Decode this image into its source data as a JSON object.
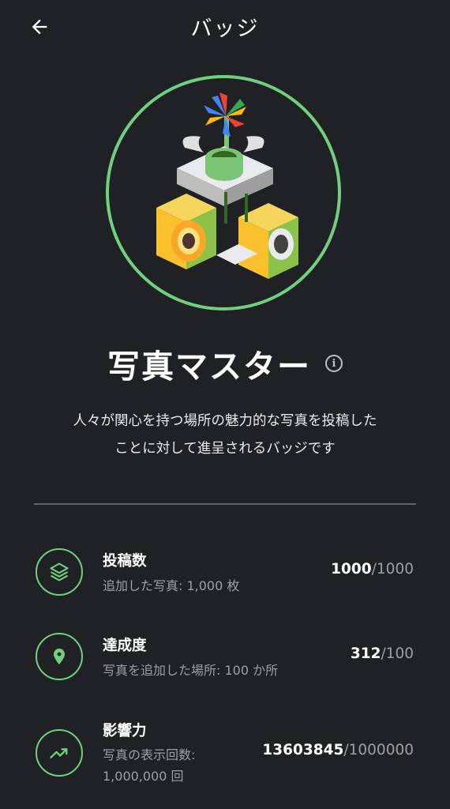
{
  "header": {
    "title": "バッジ",
    "back_icon": "arrow-left-icon"
  },
  "badge": {
    "name": "写真マスター",
    "description_line1": "人々が関心を持つ場所の魅力的な写真を投稿した",
    "description_line2": "ことに対して進呈されるバッジです",
    "ring_color": "#6fd17e"
  },
  "stats": [
    {
      "icon": "layers-icon",
      "label": "投稿数",
      "sub_line1": "追加した写真: 1,000 枚",
      "sub_line2": "",
      "current": "1000",
      "target": "/1000"
    },
    {
      "icon": "location-pin-icon",
      "label": "達成度",
      "sub_line1": "写真を追加した場所: 100 か所",
      "sub_line2": "",
      "current": "312",
      "target": "/100"
    },
    {
      "icon": "trending-up-icon",
      "label": "影響力",
      "sub_line1": "写真の表示回数:",
      "sub_line2": "1,000,000 回",
      "current": "13603845",
      "target": "/1000000"
    }
  ]
}
